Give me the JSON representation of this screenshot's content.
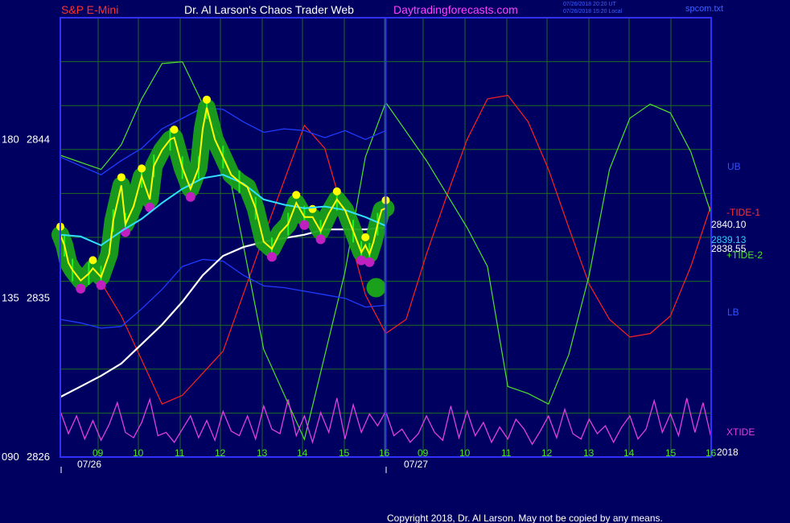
{
  "header": {
    "symbol": "S&P E-Mini",
    "author": "Dr. Al Larson's Chaos Trader Web",
    "site": "Daytradingforecasts.com",
    "timestamp_ut": "07/26/2018 20:20 UT",
    "timestamp_local": "07/26/2018 15:20 Local",
    "file": "spcom.txt"
  },
  "footer": {
    "copyright": "Copyright 2018, Dr. Al Larson. May not be copied by any means."
  },
  "colors": {
    "background": "#000060",
    "frame": "#3030ff",
    "grid": "#1f6a1f",
    "price": "#ffff00",
    "tide1": "#ff2020",
    "tide2": "#50e030",
    "bands": "#1e3cff",
    "avg_cyan": "#30e0ff",
    "avg_white": "#ffffff",
    "xtide": "#e040e0"
  },
  "chart_data": {
    "type": "line",
    "title": "S&P E-Mini",
    "y_ticks": [
      {
        "left": "180",
        "value": 2844
      },
      {
        "left": "135",
        "value": 2835
      },
      {
        "left": "090",
        "value": 2826
      }
    ],
    "ylim": [
      2826,
      2844
    ],
    "x_hour_ticks": [
      "09",
      "10",
      "11",
      "12",
      "13",
      "14",
      "15",
      "16",
      "09",
      "10",
      "11",
      "12",
      "13",
      "14",
      "15",
      "16"
    ],
    "x_dates": [
      "07/26",
      "07/27"
    ],
    "year": "2018",
    "x_range_hours": [
      0,
      16
    ],
    "now_line_hour": 8,
    "right_labels": {
      "ub": "UB",
      "lb": "LB",
      "tide1": "-TIDE-1",
      "tide2": "+TIDE-2",
      "xtide": "XTIDE",
      "last_price": "2840.10",
      "cyan_value": "2839.13",
      "white_value": "2838.55"
    },
    "series": [
      {
        "name": "-TIDE-1",
        "x": [
          0,
          1,
          1.5,
          2,
          2.5,
          3,
          4,
          5,
          6,
          6.5,
          7,
          7.5,
          8,
          8.5,
          9,
          9.5,
          10,
          10.5,
          11,
          11.5,
          12,
          12.5,
          13,
          13.5,
          14,
          14.5,
          15,
          15.5,
          16
        ],
        "values": [
          2837.6,
          2835.9,
          2834.0,
          2831.5,
          2829.0,
          2829.5,
          2832.0,
          2838.5,
          2844.8,
          2843.5,
          2839.5,
          2835.2,
          2833.0,
          2833.8,
          2837.5,
          2840.8,
          2844.0,
          2846.3,
          2846.5,
          2845.0,
          2842.3,
          2839.0,
          2835.8,
          2833.8,
          2832.8,
          2833.0,
          2834.0,
          2836.8,
          2840.3
        ]
      },
      {
        "name": "+TIDE-2",
        "x": [
          0,
          1,
          1.5,
          2,
          2.5,
          3,
          3.5,
          4,
          4.5,
          5,
          6,
          7,
          7.5,
          8,
          9,
          10,
          10.5,
          11,
          11.5,
          12,
          12.5,
          13,
          13.5,
          14,
          14.5,
          15,
          15.5,
          16
        ],
        "values": [
          2843.1,
          2842.3,
          2843.7,
          2846.3,
          2848.3,
          2848.4,
          2846.0,
          2843.8,
          2838.0,
          2832.1,
          2827.0,
          2836.5,
          2843.0,
          2846.1,
          2842.8,
          2839.0,
          2836.8,
          2830.0,
          2829.6,
          2829.0,
          2831.8,
          2836.3,
          2842.3,
          2845.2,
          2846.0,
          2845.5,
          2843.3,
          2839.8
        ]
      },
      {
        "name": "UB",
        "x": [
          0,
          0.5,
          1,
          1.5,
          2,
          2.5,
          3,
          3.5,
          4,
          4.5,
          5,
          5.5,
          6,
          6.5,
          7,
          7.5,
          8
        ],
        "values": [
          2843.0,
          2842.5,
          2842.0,
          2842.8,
          2843.5,
          2844.6,
          2845.2,
          2845.8,
          2845.7,
          2845.0,
          2844.4,
          2844.6,
          2844.5,
          2844.1,
          2844.5,
          2844.0,
          2844.5
        ]
      },
      {
        "name": "LB",
        "x": [
          0,
          0.5,
          1,
          1.5,
          2,
          2.5,
          3,
          3.5,
          4,
          4.5,
          5,
          5.5,
          6,
          6.5,
          7,
          7.5,
          8
        ],
        "values": [
          2833.8,
          2833.6,
          2833.3,
          2833.4,
          2834.4,
          2835.5,
          2836.8,
          2837.2,
          2837.1,
          2836.3,
          2835.7,
          2835.6,
          2835.4,
          2835.2,
          2835.0,
          2834.5,
          2834.6
        ]
      },
      {
        "name": "2839.13",
        "x": [
          0,
          0.5,
          1,
          1.5,
          2,
          2.5,
          3,
          3.5,
          4,
          4.5,
          5,
          5.5,
          6,
          6.5,
          7,
          7.5,
          8
        ],
        "values": [
          2838.6,
          2838.5,
          2838.0,
          2838.8,
          2839.5,
          2840.4,
          2841.2,
          2841.8,
          2842.0,
          2841.5,
          2840.6,
          2840.3,
          2840.1,
          2840.2,
          2840.0,
          2839.6,
          2839.1
        ]
      },
      {
        "name": "2838.55",
        "x": [
          0,
          0.5,
          1,
          1.5,
          2,
          2.5,
          3,
          3.5,
          4,
          4.5,
          5,
          5.5,
          6,
          6.5,
          7,
          7.5,
          8
        ],
        "values": [
          2829.4,
          2830.0,
          2830.6,
          2831.3,
          2832.4,
          2833.5,
          2834.8,
          2836.3,
          2837.4,
          2837.9,
          2838.2,
          2838.4,
          2838.6,
          2838.9,
          2838.9,
          2838.9,
          2839.0
        ]
      },
      {
        "name": "2840.10",
        "x": [
          0,
          0.1,
          0.2,
          0.3,
          0.5,
          0.7,
          0.8,
          1.0,
          1.2,
          1.3,
          1.5,
          1.6,
          1.8,
          2.0,
          2.2,
          2.3,
          2.5,
          2.7,
          2.8,
          3.0,
          3.2,
          3.4,
          3.5,
          3.6,
          3.8,
          4.0,
          4.2,
          4.4,
          4.6,
          4.8,
          5.0,
          5.2,
          5.4,
          5.6,
          5.8,
          6.0,
          6.2,
          6.4,
          6.6,
          6.8,
          7.0,
          7.2,
          7.3,
          7.4,
          7.5,
          7.6,
          7.7,
          7.8,
          7.9,
          8.0
        ],
        "values": [
          2838.6,
          2838.0,
          2837.0,
          2836.6,
          2836.0,
          2836.4,
          2836.7,
          2836.2,
          2837.5,
          2839.4,
          2841.4,
          2839.2,
          2840.2,
          2841.9,
          2840.6,
          2842.5,
          2843.4,
          2844.0,
          2844.1,
          2842.4,
          2841.2,
          2842.4,
          2844.6,
          2845.8,
          2844.0,
          2843.0,
          2842.0,
          2841.6,
          2841.3,
          2840.1,
          2838.2,
          2837.8,
          2838.7,
          2839.2,
          2840.4,
          2839.6,
          2839.6,
          2838.8,
          2839.8,
          2840.6,
          2840.0,
          2838.8,
          2838.2,
          2837.6,
          2838.0,
          2837.5,
          2838.2,
          2839.2,
          2840.0,
          2840.1
        ]
      },
      {
        "name": "XTIDE",
        "x": [
          0,
          0.2,
          0.4,
          0.6,
          0.8,
          1.0,
          1.2,
          1.4,
          1.6,
          1.8,
          2.0,
          2.2,
          2.4,
          2.6,
          2.8,
          3.0,
          3.2,
          3.4,
          3.6,
          3.8,
          4.0,
          4.2,
          4.4,
          4.6,
          4.8,
          5.0,
          5.2,
          5.4,
          5.6,
          5.8,
          6.0,
          6.2,
          6.4,
          6.6,
          6.8,
          7.0,
          7.2,
          7.4,
          7.6,
          7.8,
          8.0,
          8.2,
          8.4,
          8.6,
          8.8,
          9.0,
          9.2,
          9.4,
          9.6,
          9.8,
          10.0,
          10.2,
          10.4,
          10.6,
          10.8,
          11.0,
          11.2,
          11.4,
          11.6,
          11.8,
          12.0,
          12.2,
          12.4,
          12.6,
          12.8,
          13.0,
          13.2,
          13.4,
          13.6,
          13.8,
          14.0,
          14.2,
          14.4,
          14.6,
          14.8,
          15.0,
          15.2,
          15.4,
          15.6,
          15.8,
          16.0
        ],
        "values": [
          0.62,
          0.28,
          0.55,
          0.2,
          0.48,
          0.18,
          0.42,
          0.75,
          0.3,
          0.22,
          0.45,
          0.8,
          0.25,
          0.3,
          0.15,
          0.35,
          0.55,
          0.22,
          0.48,
          0.18,
          0.62,
          0.32,
          0.25,
          0.55,
          0.2,
          0.7,
          0.35,
          0.28,
          0.8,
          0.25,
          0.55,
          0.15,
          0.6,
          0.3,
          0.82,
          0.2,
          0.72,
          0.3,
          0.58,
          0.4,
          0.62,
          0.25,
          0.35,
          0.15,
          0.28,
          0.55,
          0.3,
          0.18,
          0.7,
          0.22,
          0.62,
          0.25,
          0.45,
          0.15,
          0.38,
          0.2,
          0.5,
          0.35,
          0.12,
          0.32,
          0.55,
          0.22,
          0.65,
          0.28,
          0.2,
          0.5,
          0.28,
          0.4,
          0.15,
          0.38,
          0.55,
          0.2,
          0.35,
          0.78,
          0.3,
          0.58,
          0.25,
          0.82,
          0.3,
          0.75,
          0.22
        ]
      }
    ]
  }
}
